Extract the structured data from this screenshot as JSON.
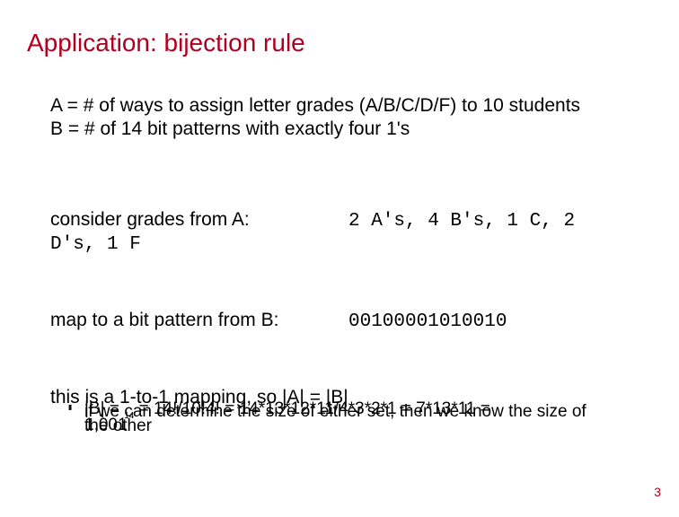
{
  "title": "Application: bijection rule",
  "defs": {
    "A": "A = # of ways to assign letter grades (A/B/C/D/F) to 10 students",
    "B": "B = # of 14 bit patterns with exactly four 1's"
  },
  "consider": {
    "label": "consider grades from A:",
    "value_line1": "2 A's, 4 B's, 1 C, 2",
    "value_line2": "D's, 1 F"
  },
  "map": {
    "label": "map to a bit pattern from B:",
    "value": "00100001010010"
  },
  "conclusion": {
    "head": "this is a 1-to-1 mapping, so |A| = |B|",
    "b1_a": "|B| = ",
    "b1_sub": "14",
    "b1_b": " = 14!/10!4! = 14*13*12*11/4*3*2*1 = 7*13*11 =",
    "b2": "if we can determine the size of either set, then we know the size of",
    "b3a": "1,001",
    "b3b": "the other"
  },
  "pagenum": "3"
}
